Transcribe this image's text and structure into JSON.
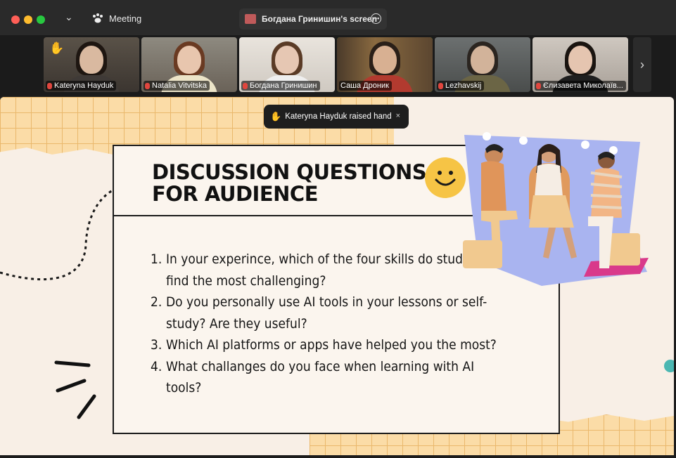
{
  "window": {
    "app_title": "Meeting",
    "share_title": "Богдана Гринишин's screen",
    "more_icon": "ellipsis-icon"
  },
  "participants": [
    {
      "name": "Kateryna Hayduk",
      "muted": true,
      "hand_raised": true
    },
    {
      "name": "Natalia Vitvitska",
      "muted": true
    },
    {
      "name": "Богдана Гринишин",
      "muted": true
    },
    {
      "name": "Саша Дроник",
      "muted": false,
      "active_speaker": true
    },
    {
      "name": "Lezhavskij",
      "muted": true
    },
    {
      "name": "Єлизавета Миколаїв...",
      "muted": true
    }
  ],
  "notification": {
    "text": "Kateryna Hayduk raised hand",
    "close": "×"
  },
  "slide": {
    "title_line1": "DISCUSSION QUESTIONS",
    "title_line2": "FOR AUDIENCE",
    "questions": [
      {
        "num": "1.",
        "text": "In your experince, which of the four skills do students find the most challenging?"
      },
      {
        "num": "2.",
        "text": "Do you personally use AI tools in your lessons or self-study? Are they useful?"
      },
      {
        "num": "3.",
        "text": "Which AI platforms or apps have helped you the most?"
      },
      {
        "num": "4.",
        "text": "What challanges do you face when learning with AI tools?"
      }
    ]
  },
  "colors": {
    "accent_green": "#3fbf3f",
    "slide_bg": "#f8efe6",
    "grid_yellow": "#fbdca7",
    "illustration_blue": "#a9b4f0",
    "smiley_yellow": "#f6c445"
  }
}
